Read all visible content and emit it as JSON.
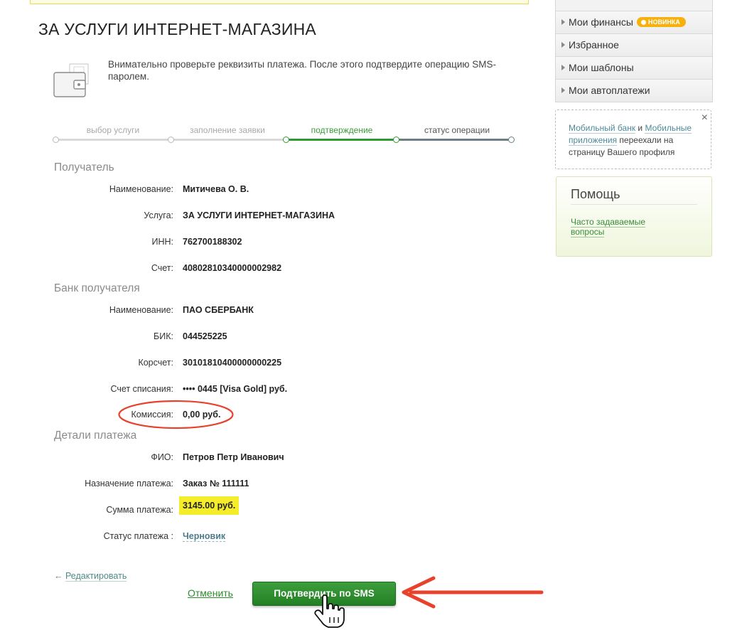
{
  "page": {
    "title": "ЗА УСЛУГИ ИНТЕРНЕТ-МАГАЗИНА",
    "info": "Внимательно проверьте реквизиты платежа. После этого подтвердите операцию SMS-паролем."
  },
  "steps": [
    {
      "label": "выбор услуги",
      "state": "done"
    },
    {
      "label": "заполнение заявки",
      "state": "done"
    },
    {
      "label": "подтверждение",
      "state": "active"
    },
    {
      "label": "статус операции",
      "state": "pending"
    }
  ],
  "recipient": {
    "heading": "Получатель",
    "rows": [
      {
        "label": "Наименование:",
        "value": "Митичева О. В."
      },
      {
        "label": "Услуга:",
        "value": "ЗА УСЛУГИ ИНТЕРНЕТ-МАГАЗИНА"
      },
      {
        "label": "ИНН:",
        "value": "762700188302"
      },
      {
        "label": "Счет:",
        "value": "40802810340000002982"
      }
    ]
  },
  "bank": {
    "heading": "Банк получателя",
    "rows": [
      {
        "label": "Наименование:",
        "value": "ПАО СБЕРБАНК"
      },
      {
        "label": "БИК:",
        "value": "044525225"
      },
      {
        "label": "Корсчет:",
        "value": "30101810400000000225"
      },
      {
        "label": "Счет списания:",
        "value": "•••• 0445  [Visa Gold]  руб."
      },
      {
        "label": "Комиссия:",
        "value": "0,00 руб."
      }
    ]
  },
  "details": {
    "heading": "Детали платежа",
    "rows": [
      {
        "label": "ФИО:",
        "value": "Петров Петр Иванович"
      },
      {
        "label": "Назначение платежа:",
        "value": "Заказ № 111111"
      },
      {
        "label": "Сумма платежа:",
        "value": "3145.00 руб."
      },
      {
        "label": "Статус платежа :",
        "value": "Черновик"
      }
    ]
  },
  "actions": {
    "edit": "Редактировать",
    "edit_arrow": "←",
    "cancel": "Отменить",
    "confirm": "Подтвердить по SMS"
  },
  "sidebar": {
    "menu": [
      {
        "label": "Мои финансы",
        "badge": "НОВИНКА"
      },
      {
        "label": "Избранное"
      },
      {
        "label": "Мои шаблоны"
      },
      {
        "label": "Мои автоплатежи"
      }
    ],
    "notice": {
      "link1": "Мобильный банк",
      "and": " и ",
      "link2": "Мобильные приложения",
      "rest": " переехали на страницу Вашего профиля",
      "close": "×"
    },
    "help": {
      "title": "Помощь",
      "link": "Часто задаваемые вопросы"
    }
  },
  "colors": {
    "accent_green": "#2f8f2f",
    "highlight_yellow": "#f5ec2a",
    "annotation_red": "#e8412c",
    "badge_orange": "#f6b10e"
  },
  "icons": [
    "wallet-icon",
    "menu-triangle-icon",
    "close-icon",
    "hand-cursor-icon",
    "red-arrow-annotation"
  ]
}
